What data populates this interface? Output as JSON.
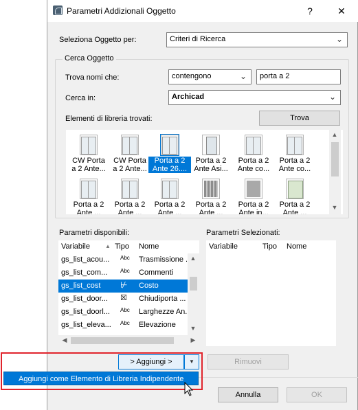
{
  "window": {
    "title": "Parametri Addizionali Oggetto",
    "help_button": "?",
    "close_button": "✕"
  },
  "select_by": {
    "label": "Seleziona Oggetto per:",
    "value": "Criteri di Ricerca"
  },
  "search": {
    "group_label": "Cerca Oggetto",
    "find_names_label": "Trova nomi che:",
    "operator_value": "contengono",
    "query_value": "porta a 2",
    "search_in_label": "Cerca in:",
    "search_in_value": "Archicad",
    "found_label": "Elementi di libreria trovati:",
    "find_button": "Trova"
  },
  "gallery": {
    "items": [
      {
        "line1": "CW Porta",
        "line2": "a 2 Ante..."
      },
      {
        "line1": "CW Porta",
        "line2": "a 2 Ante..."
      },
      {
        "line1": "Porta a 2",
        "line2": "Ante 26...."
      },
      {
        "line1": "Porta a 2",
        "line2": "Ante Asi..."
      },
      {
        "line1": "Porta a 2",
        "line2": "Ante co..."
      },
      {
        "line1": "Porta a 2",
        "line2": "Ante co..."
      },
      {
        "line1": "Porta a 2",
        "line2": "Ante ..."
      },
      {
        "line1": "Porta a 2",
        "line2": "Ante ..."
      },
      {
        "line1": "Porta a 2",
        "line2": "Ante ..."
      },
      {
        "line1": "Porta a 2",
        "line2": "Ante ..."
      },
      {
        "line1": "Porta a 2",
        "line2": "Ante in..."
      },
      {
        "line1": "Porta a 2",
        "line2": "Ante ..."
      }
    ]
  },
  "available": {
    "label": "Parametri disponibili:",
    "col_variable": "Variabile",
    "sort_arrow": "▲",
    "col_type": "Tipo",
    "col_name": "Nome",
    "rows": [
      {
        "variable": "gs_list_acou...",
        "type": "Abc",
        "name": "Trasmissione ..."
      },
      {
        "variable": "gs_list_com...",
        "type": "Abc",
        "name": "Commenti"
      },
      {
        "variable": "gs_list_cost",
        "type": "⊬",
        "name": "Costo"
      },
      {
        "variable": "gs_list_door...",
        "type": "☒",
        "name": "Chiudiporta ..."
      },
      {
        "variable": "gs_list_doorl...",
        "type": "Abc",
        "name": "Larghezze An..."
      },
      {
        "variable": "gs_list_eleva...",
        "type": "Abc",
        "name": "Elevazione"
      }
    ]
  },
  "selected": {
    "label": "Parametri Selezionati:",
    "col_variable": "Variabile",
    "col_type": "Tipo",
    "col_name": "Nome"
  },
  "actions": {
    "add_button": "> Aggiungi >",
    "add_dropdown_arrow": "▼",
    "remove_button": "Rimuovi",
    "popup_item": "Aggiungi come Elemento di Libreria Indipendente",
    "cancel_button": "Annulla",
    "ok_button": "OK"
  },
  "colors": {
    "selection": "#0078d7",
    "highlight_box": "#e0242c"
  }
}
